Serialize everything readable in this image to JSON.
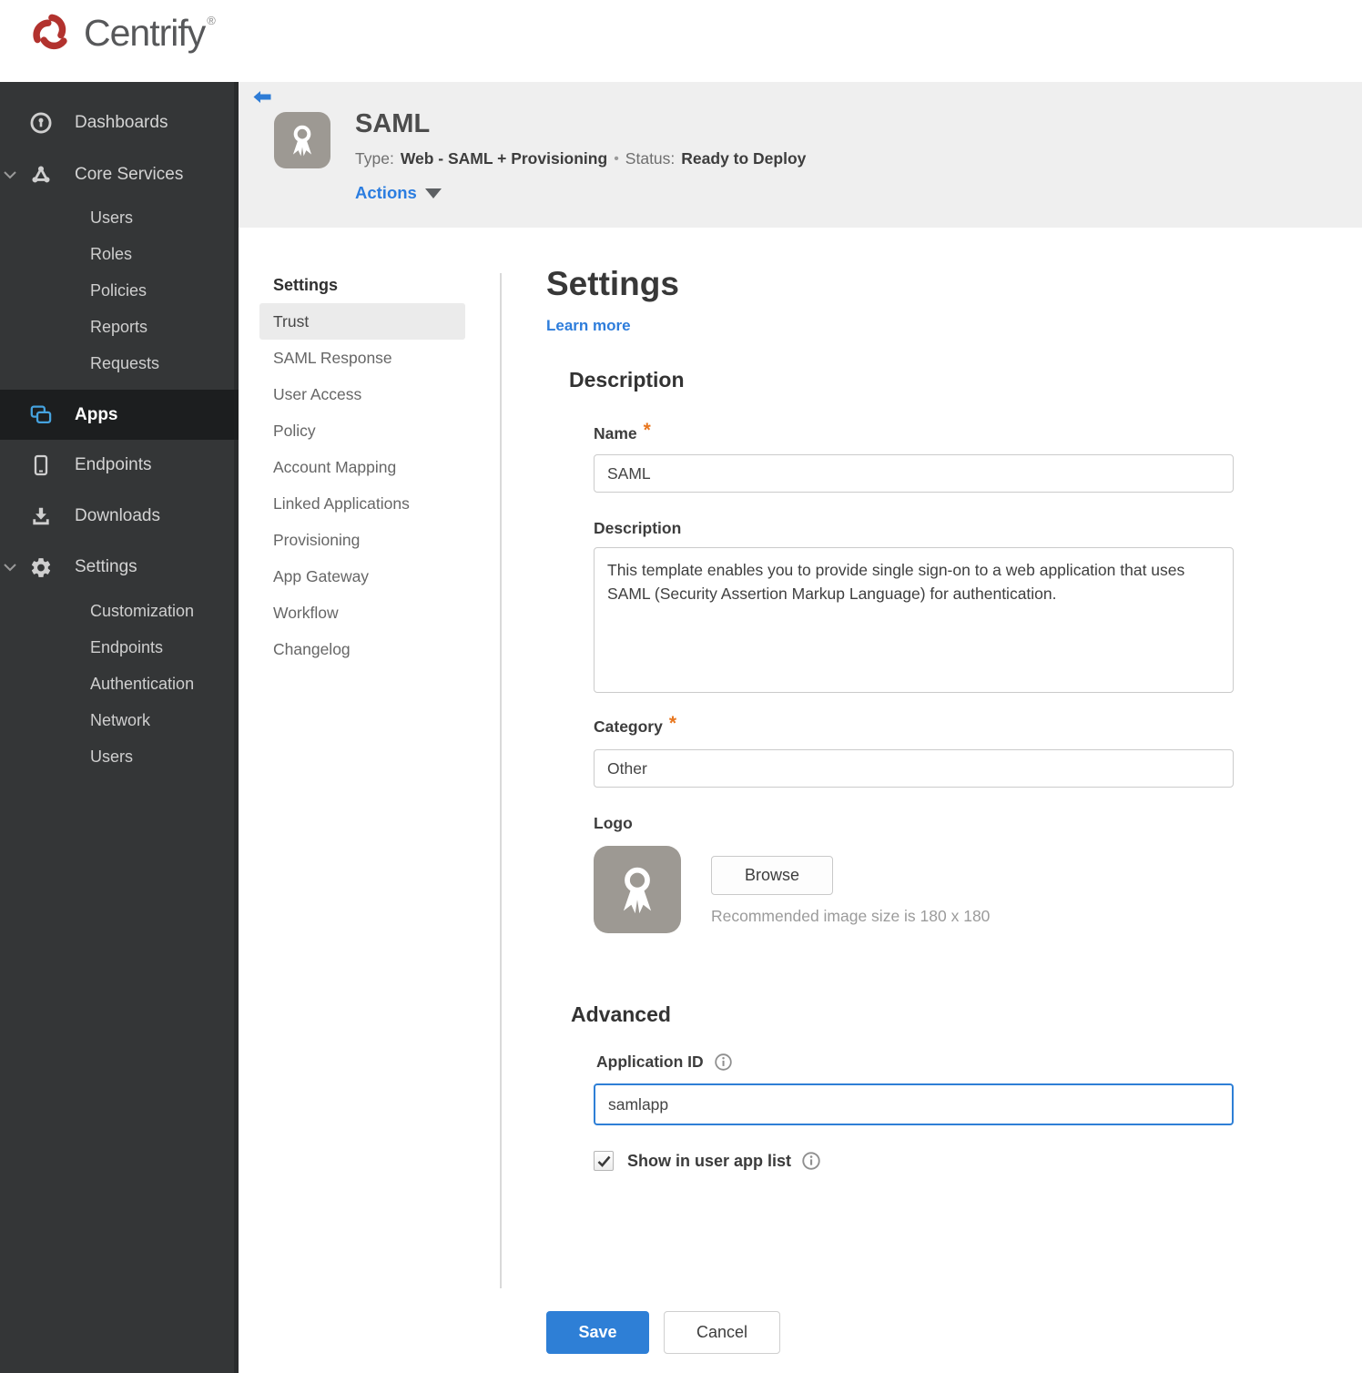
{
  "brand": {
    "name": "Centrify",
    "trademark": "®",
    "logo_color": "#b2322e"
  },
  "sidebar": {
    "items": [
      {
        "label": "Dashboards",
        "icon": "gauge-icon"
      },
      {
        "label": "Core Services",
        "icon": "core-services-icon",
        "expanded": true,
        "children": [
          "Users",
          "Roles",
          "Policies",
          "Reports",
          "Requests"
        ]
      },
      {
        "label": "Apps",
        "icon": "apps-icon",
        "active": true,
        "icon_color": "#45a2de"
      },
      {
        "label": "Endpoints",
        "icon": "smartphone-icon"
      },
      {
        "label": "Downloads",
        "icon": "download-icon"
      },
      {
        "label": "Settings",
        "icon": "gear-icon",
        "expanded": true,
        "children": [
          "Customization",
          "Endpoints",
          "Authentication",
          "Network",
          "Users"
        ]
      }
    ]
  },
  "header": {
    "title": "SAML",
    "type_label": "Type:",
    "type_value": "Web - SAML + Provisioning",
    "separator": "•",
    "status_label": "Status:",
    "status_value": "Ready to Deploy",
    "status_color": "#a3231d",
    "actions_label": "Actions",
    "accent_blue": "#2b7de0"
  },
  "subnav": {
    "heading": "Settings",
    "active_item": "Trust",
    "items": [
      "Trust",
      "SAML Response",
      "User Access",
      "Policy",
      "Account Mapping",
      "Linked Applications",
      "Provisioning",
      "App Gateway",
      "Workflow",
      "Changelog"
    ]
  },
  "main": {
    "heading": "Settings",
    "learn_more_label": "Learn more",
    "description_section": {
      "heading": "Description",
      "name_label": "Name",
      "required_mark": "*",
      "name_value": "SAML",
      "description_label": "Description",
      "description_value": "This template enables you to provide single sign-on to a web application that uses SAML (Security Assertion Markup Language) for authentication.",
      "category_label": "Category",
      "category_value": "Other",
      "logo_label": "Logo",
      "browse_label": "Browse",
      "recommended_text": "Recommended image size is 180 x 180"
    },
    "advanced_section": {
      "heading": "Advanced",
      "application_id_label": "Application ID",
      "application_id_value": "samlapp",
      "show_in_app_list_label": "Show in user app list",
      "checkbox_checked": true
    },
    "footer": {
      "save_label": "Save",
      "cancel_label": "Cancel"
    }
  }
}
